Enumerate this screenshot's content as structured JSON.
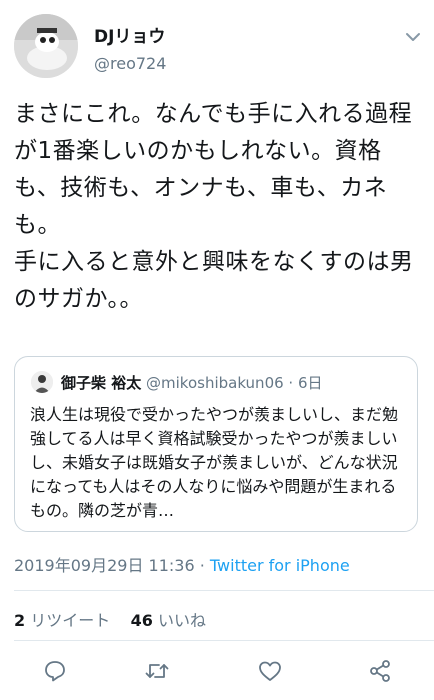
{
  "author": {
    "name": "DJリョウ",
    "handle": "@reo724"
  },
  "tweet": {
    "text": "まさにこれ。なんでも手に入れる過程が1番楽しいのかもしれない。資格も、技術も、オンナも、車も、カネも。\n手に入ると意外と興味をなくすのは男のサガか。。"
  },
  "quote": {
    "name": "御子柴 裕太",
    "meta": "@mikoshibakun06 · 6日",
    "text": "浪人生は現役で受かったやつが羨ましいし、まだ勉強してる人は早く資格試験受かったやつが羨ましいし、未婚女子は既婚女子が羨ましいが、どんな状況になっても人はその人なりに悩みや問題が生まれるもの。隣の芝が青…"
  },
  "timestamp": {
    "datetime": "2019年09月29日 11:36",
    "separator": " · ",
    "source": "Twitter for iPhone"
  },
  "stats": {
    "retweets_count": "2",
    "retweets_label": "リツイート",
    "likes_count": "46",
    "likes_label": "いいね"
  },
  "colors": {
    "accent": "#1da1f2",
    "secondary_text": "#657786",
    "icon_gray": "#657786"
  },
  "icons": {
    "caret": "chevron-down-icon",
    "reply": "reply-icon",
    "retweet": "retweet-icon",
    "like": "heart-icon",
    "share": "share-icon"
  }
}
